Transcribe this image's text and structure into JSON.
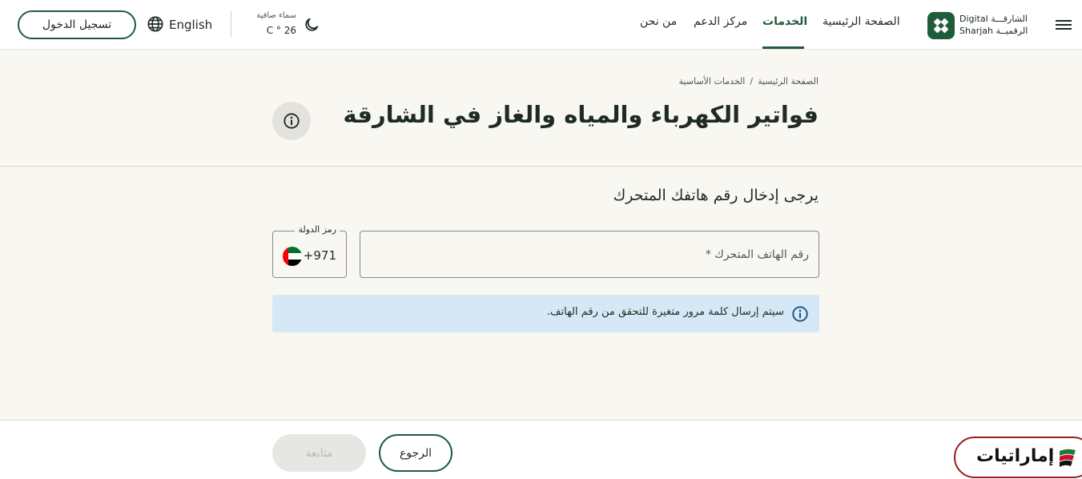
{
  "header": {
    "logo": {
      "arabic_line1": "الشارقـــة",
      "arabic_line2": "الرقميــة",
      "english_line1": "Digital",
      "english_line2": "Sharjah"
    },
    "nav": [
      {
        "label": "الصفحة الرئيسية",
        "active": false
      },
      {
        "label": "الخدمات",
        "active": true
      },
      {
        "label": "مركز الدعم",
        "active": false
      },
      {
        "label": "من نحن",
        "active": false
      }
    ],
    "weather": {
      "label": "سماء صافية",
      "temperature": "C ° 26",
      "icon": "moon-icon"
    },
    "language_label": "English",
    "login_label": "تسجيل الدخول"
  },
  "breadcrumb": {
    "home": "الصفحة الرئيسية",
    "separator": "/",
    "current": "الخدمات الأساسية"
  },
  "page": {
    "title": "فواتير الكهرباء والمياه والغاز في الشارقة"
  },
  "form": {
    "prompt": "يرجى إدخال رقم هاتفك المتحرك",
    "phone_placeholder": "رقم الهاتف المتحرك *",
    "phone_value": "",
    "country_label": "رمز الدولة",
    "country_code": "+971",
    "notice": "سيتم إرسال كلمة مرور متغيرة للتحقق من رقم الهاتف."
  },
  "actions": {
    "back_label": "الرجوع",
    "continue_label": "متابعة",
    "continue_enabled": false
  },
  "badge": {
    "label": "إماراتيات"
  },
  "colors": {
    "primary": "#1f5c3a",
    "notice_bg": "#d6e8f5",
    "page_bg": "#f8f7f2",
    "badge_border": "#9b1c1c"
  }
}
